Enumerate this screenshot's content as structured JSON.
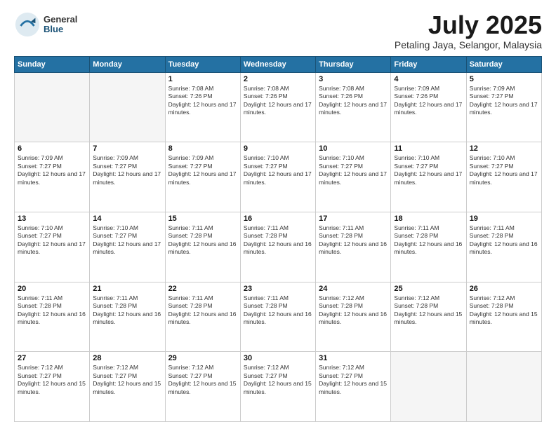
{
  "logo": {
    "general": "General",
    "blue": "Blue"
  },
  "title": "July 2025",
  "location": "Petaling Jaya, Selangor, Malaysia",
  "days_of_week": [
    "Sunday",
    "Monday",
    "Tuesday",
    "Wednesday",
    "Thursday",
    "Friday",
    "Saturday"
  ],
  "weeks": [
    [
      {
        "day": null
      },
      {
        "day": null
      },
      {
        "day": "1",
        "sunrise": "7:08 AM",
        "sunset": "7:26 PM",
        "daylight": "12 hours and 17 minutes."
      },
      {
        "day": "2",
        "sunrise": "7:08 AM",
        "sunset": "7:26 PM",
        "daylight": "12 hours and 17 minutes."
      },
      {
        "day": "3",
        "sunrise": "7:08 AM",
        "sunset": "7:26 PM",
        "daylight": "12 hours and 17 minutes."
      },
      {
        "day": "4",
        "sunrise": "7:09 AM",
        "sunset": "7:26 PM",
        "daylight": "12 hours and 17 minutes."
      },
      {
        "day": "5",
        "sunrise": "7:09 AM",
        "sunset": "7:27 PM",
        "daylight": "12 hours and 17 minutes."
      }
    ],
    [
      {
        "day": "6",
        "sunrise": "7:09 AM",
        "sunset": "7:27 PM",
        "daylight": "12 hours and 17 minutes."
      },
      {
        "day": "7",
        "sunrise": "7:09 AM",
        "sunset": "7:27 PM",
        "daylight": "12 hours and 17 minutes."
      },
      {
        "day": "8",
        "sunrise": "7:09 AM",
        "sunset": "7:27 PM",
        "daylight": "12 hours and 17 minutes."
      },
      {
        "day": "9",
        "sunrise": "7:10 AM",
        "sunset": "7:27 PM",
        "daylight": "12 hours and 17 minutes."
      },
      {
        "day": "10",
        "sunrise": "7:10 AM",
        "sunset": "7:27 PM",
        "daylight": "12 hours and 17 minutes."
      },
      {
        "day": "11",
        "sunrise": "7:10 AM",
        "sunset": "7:27 PM",
        "daylight": "12 hours and 17 minutes."
      },
      {
        "day": "12",
        "sunrise": "7:10 AM",
        "sunset": "7:27 PM",
        "daylight": "12 hours and 17 minutes."
      }
    ],
    [
      {
        "day": "13",
        "sunrise": "7:10 AM",
        "sunset": "7:27 PM",
        "daylight": "12 hours and 17 minutes."
      },
      {
        "day": "14",
        "sunrise": "7:10 AM",
        "sunset": "7:27 PM",
        "daylight": "12 hours and 17 minutes."
      },
      {
        "day": "15",
        "sunrise": "7:11 AM",
        "sunset": "7:28 PM",
        "daylight": "12 hours and 16 minutes."
      },
      {
        "day": "16",
        "sunrise": "7:11 AM",
        "sunset": "7:28 PM",
        "daylight": "12 hours and 16 minutes."
      },
      {
        "day": "17",
        "sunrise": "7:11 AM",
        "sunset": "7:28 PM",
        "daylight": "12 hours and 16 minutes."
      },
      {
        "day": "18",
        "sunrise": "7:11 AM",
        "sunset": "7:28 PM",
        "daylight": "12 hours and 16 minutes."
      },
      {
        "day": "19",
        "sunrise": "7:11 AM",
        "sunset": "7:28 PM",
        "daylight": "12 hours and 16 minutes."
      }
    ],
    [
      {
        "day": "20",
        "sunrise": "7:11 AM",
        "sunset": "7:28 PM",
        "daylight": "12 hours and 16 minutes."
      },
      {
        "day": "21",
        "sunrise": "7:11 AM",
        "sunset": "7:28 PM",
        "daylight": "12 hours and 16 minutes."
      },
      {
        "day": "22",
        "sunrise": "7:11 AM",
        "sunset": "7:28 PM",
        "daylight": "12 hours and 16 minutes."
      },
      {
        "day": "23",
        "sunrise": "7:11 AM",
        "sunset": "7:28 PM",
        "daylight": "12 hours and 16 minutes."
      },
      {
        "day": "24",
        "sunrise": "7:12 AM",
        "sunset": "7:28 PM",
        "daylight": "12 hours and 16 minutes."
      },
      {
        "day": "25",
        "sunrise": "7:12 AM",
        "sunset": "7:28 PM",
        "daylight": "12 hours and 15 minutes."
      },
      {
        "day": "26",
        "sunrise": "7:12 AM",
        "sunset": "7:28 PM",
        "daylight": "12 hours and 15 minutes."
      }
    ],
    [
      {
        "day": "27",
        "sunrise": "7:12 AM",
        "sunset": "7:27 PM",
        "daylight": "12 hours and 15 minutes."
      },
      {
        "day": "28",
        "sunrise": "7:12 AM",
        "sunset": "7:27 PM",
        "daylight": "12 hours and 15 minutes."
      },
      {
        "day": "29",
        "sunrise": "7:12 AM",
        "sunset": "7:27 PM",
        "daylight": "12 hours and 15 minutes."
      },
      {
        "day": "30",
        "sunrise": "7:12 AM",
        "sunset": "7:27 PM",
        "daylight": "12 hours and 15 minutes."
      },
      {
        "day": "31",
        "sunrise": "7:12 AM",
        "sunset": "7:27 PM",
        "daylight": "12 hours and 15 minutes."
      },
      {
        "day": null
      },
      {
        "day": null
      }
    ]
  ]
}
